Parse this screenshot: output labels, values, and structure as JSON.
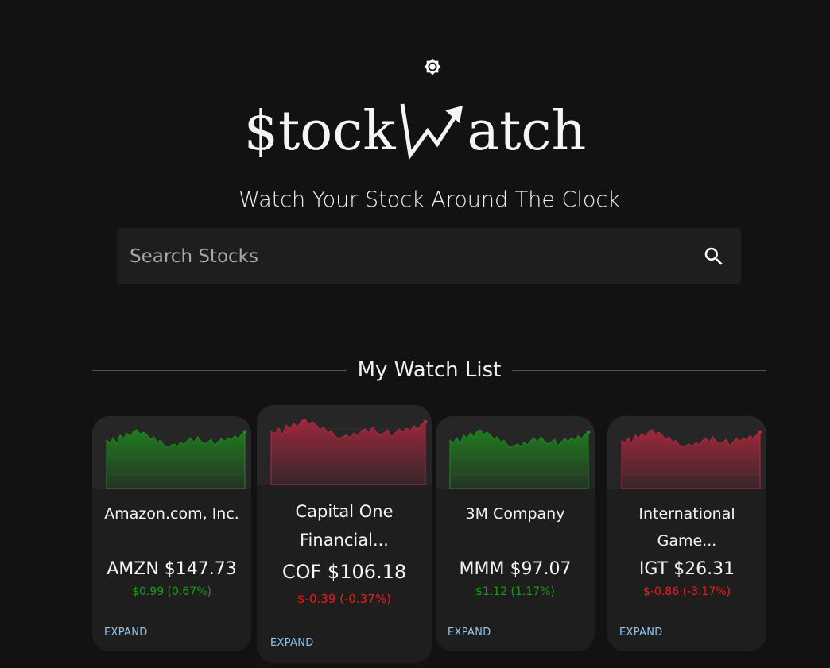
{
  "app": {
    "logo_left": "$tock",
    "logo_right": "atch",
    "tagline": "Watch Your Stock Around The Clock"
  },
  "search": {
    "placeholder": "Search Stocks"
  },
  "watchlist": {
    "title": "My Watch List",
    "cards": [
      {
        "name": "Amazon.com, Inc.",
        "symbol": "AMZN",
        "price": "$147.73",
        "change": "$0.99 (0.67%)",
        "trend": "up",
        "expand": "EXPAND"
      },
      {
        "name": "Capital One Financial...",
        "symbol": "COF",
        "price": "$106.18",
        "change": "$-0.39 (-0.37%)",
        "trend": "down",
        "expand": "EXPAND"
      },
      {
        "name": "3M Company",
        "symbol": "MMM",
        "price": "$97.07",
        "change": "$1.12 (1.17%)",
        "trend": "up",
        "expand": "EXPAND"
      },
      {
        "name": "International Game...",
        "symbol": "IGT",
        "price": "$26.31",
        "change": "$-0.86 (-3.17%)",
        "trend": "down",
        "expand": "EXPAND"
      }
    ]
  },
  "colors": {
    "up": "#1d9a1d",
    "down": "#e61e1e",
    "link": "#8fc8f2",
    "background": "#121212",
    "card": "#1e1e1e"
  },
  "icons": {
    "theme": "brightness-icon",
    "search": "search-icon",
    "logo_arrow": "trend-arrow-icon"
  }
}
